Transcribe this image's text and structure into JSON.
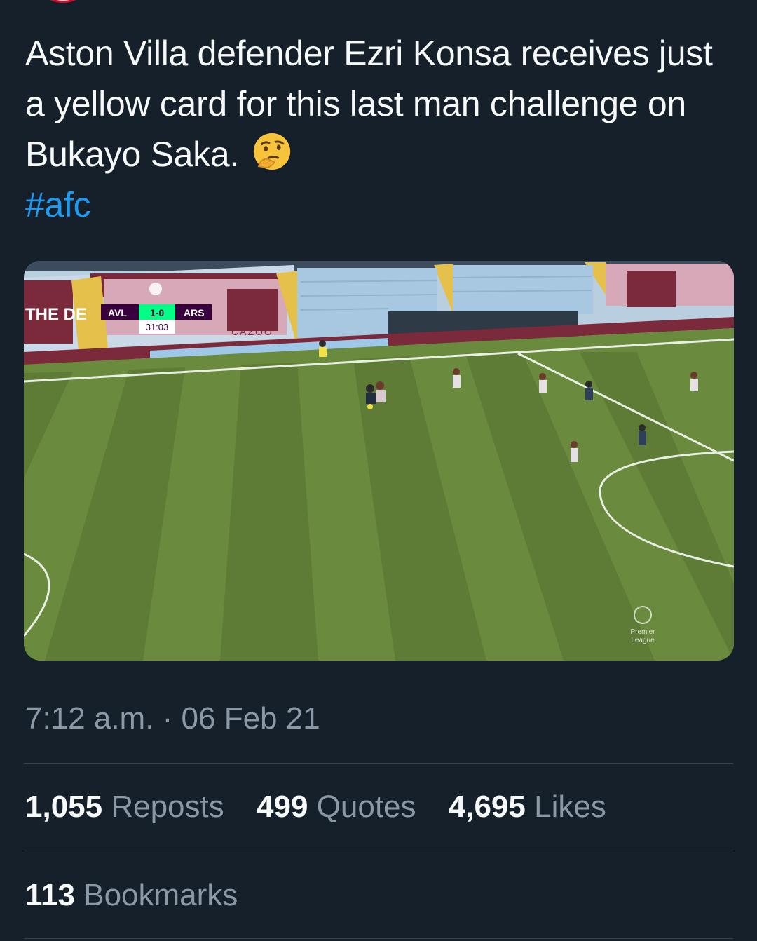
{
  "tweet": {
    "text": "Aston Villa defender Ezri Konsa receives just a yellow card for this last man challenge on Bukayo Saka.",
    "emoji": "thinking-face",
    "hashtag": "#afc",
    "timestamp": "7:12 a.m. · 06 Feb 21"
  },
  "media": {
    "scoreboard": {
      "home": "AVL",
      "score": "1-0",
      "away": "ARS",
      "clock": "31:03"
    },
    "sponsor": "CAZOO",
    "stand_text": "THE DE",
    "watermark": [
      "Premier",
      "League"
    ]
  },
  "stats": {
    "reposts": {
      "count": "1,055",
      "label": "Reposts"
    },
    "quotes": {
      "count": "499",
      "label": "Quotes"
    },
    "likes": {
      "count": "4,695",
      "label": "Likes"
    },
    "bookmarks": {
      "count": "113",
      "label": "Bookmarks"
    }
  },
  "colors": {
    "background": "#15202b",
    "text": "#e7e9ea",
    "secondary": "#8b98a5",
    "link": "#1d9bf0",
    "divider": "#38444d",
    "pitch": "#6a8a3e",
    "claret": "#7a2a3a",
    "villa_blue": "#9fc8e8"
  }
}
